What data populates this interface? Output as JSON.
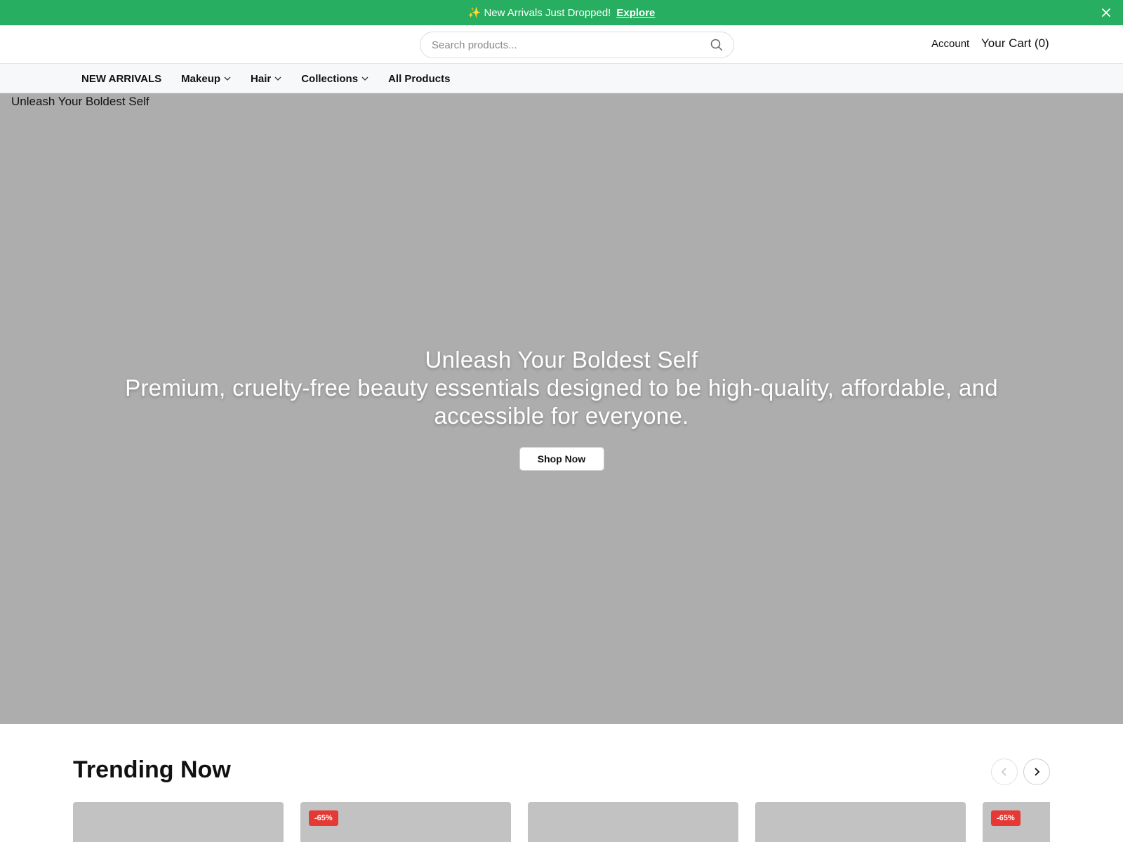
{
  "announcement": {
    "icon": "sparkles-icon",
    "message": "✨ New Arrivals Just Dropped!",
    "link_label": "Explore",
    "bg_color": "#27ae60"
  },
  "header": {
    "search_placeholder": "Search products...",
    "account_label": "Account",
    "cart_label": "Your Cart (0)"
  },
  "nav": {
    "items": [
      {
        "label": "NEW ARRIVALS",
        "dropdown": false
      },
      {
        "label": "Makeup",
        "dropdown": true
      },
      {
        "label": "Hair",
        "dropdown": true
      },
      {
        "label": "Collections",
        "dropdown": true
      },
      {
        "label": "All Products",
        "dropdown": false
      }
    ]
  },
  "hero": {
    "image_alt": "Unleash Your Boldest Self",
    "title": "Unleash Your Boldest Self",
    "subtitle": "Premium, cruelty-free beauty essentials designed to be high-quality, affordable, and accessible for everyone.",
    "cta_label": "Shop Now"
  },
  "trending": {
    "title": "Trending Now",
    "cards": [
      {
        "badge": ""
      },
      {
        "badge": "-65%"
      },
      {
        "badge": ""
      },
      {
        "badge": ""
      },
      {
        "badge": "-65%"
      }
    ]
  },
  "colors": {
    "accent": "#27ae60",
    "badge": "#e53935",
    "hero_bg": "#adadad"
  }
}
